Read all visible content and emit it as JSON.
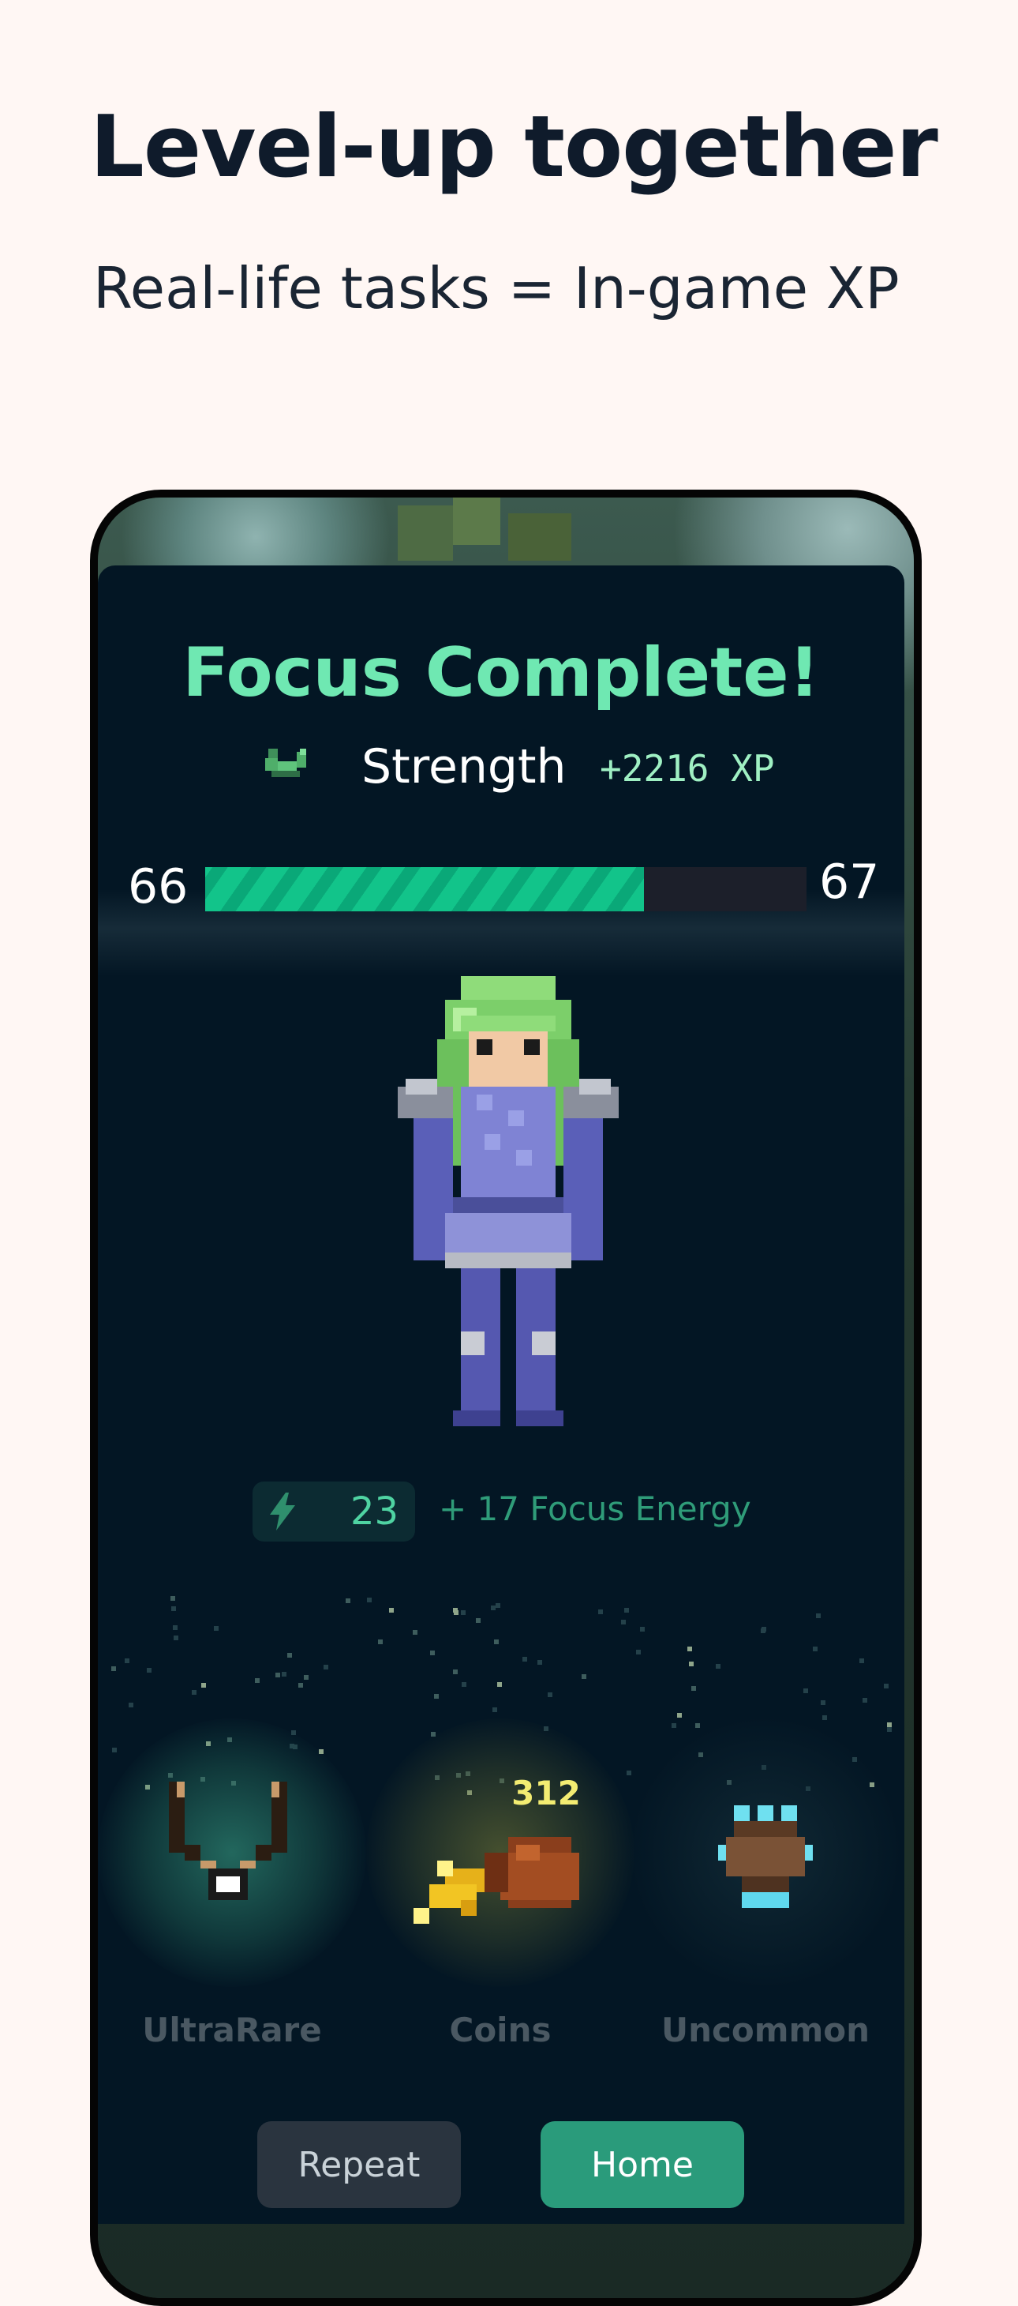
{
  "header": {
    "title": "Level-up together",
    "subtitle": "Real-life tasks = In-game XP"
  },
  "result": {
    "title": "Focus Complete!",
    "skill": {
      "icon": "bicep-icon",
      "name": "Strength",
      "xp_gain": "+2216 XP"
    },
    "level": {
      "current": "66",
      "next": "67",
      "progress_fraction": 0.73
    },
    "energy": {
      "icon": "lightning-bolt-icon",
      "value": "23",
      "gain_text": "+ 17 Focus Energy"
    }
  },
  "rewards": [
    {
      "label": "UltraRare",
      "icon": "necklace-icon"
    },
    {
      "label": "Coins",
      "icon": "coin-bag-icon",
      "count": "312"
    },
    {
      "label": "Uncommon",
      "icon": "claw-gauntlet-icon"
    }
  ],
  "actions": {
    "repeat_label": "Repeat",
    "home_label": "Home"
  },
  "colors": {
    "accent": "#6fe8b2",
    "xp_bar": "#12c48a",
    "panel": "#031624",
    "home_button": "#2a9b7b",
    "coin_text": "#f3ec72"
  }
}
